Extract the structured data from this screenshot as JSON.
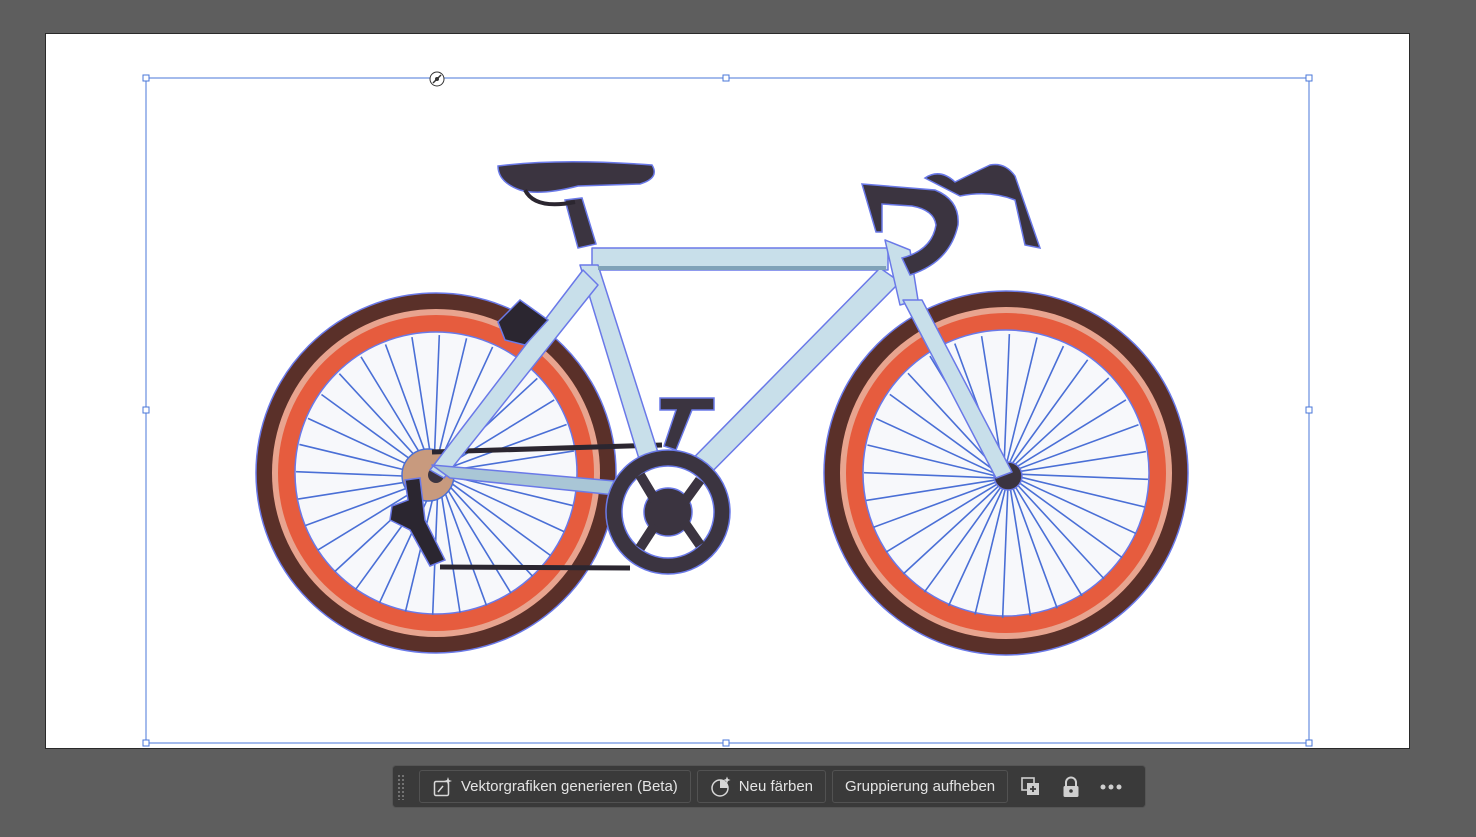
{
  "artboard": {
    "background": "#ffffff",
    "selection_color": "#4a77d9",
    "artwork_name": "road-bicycle",
    "colors": {
      "tire": "#5a3029",
      "rim": "#e65c3e",
      "rim_inner": "#e8a48f",
      "frame": "#c8dfea",
      "frame_shadow": "#7fa2b8",
      "dark_parts": "#3b3440",
      "cog": "#c89a7e"
    }
  },
  "taskbar": {
    "generate_vectors_label": "Vektorgrafiken generieren (Beta)",
    "generate_vectors_icon": "sparkle-frame-icon",
    "recolor_label": "Neu färben",
    "recolor_icon": "color-wheel-sparkle-icon",
    "ungroup_label": "Gruppierung aufheben",
    "duplicate_icon": "duplicate-icon",
    "lock_icon": "lock-icon",
    "more_icon": "more-options-icon"
  }
}
